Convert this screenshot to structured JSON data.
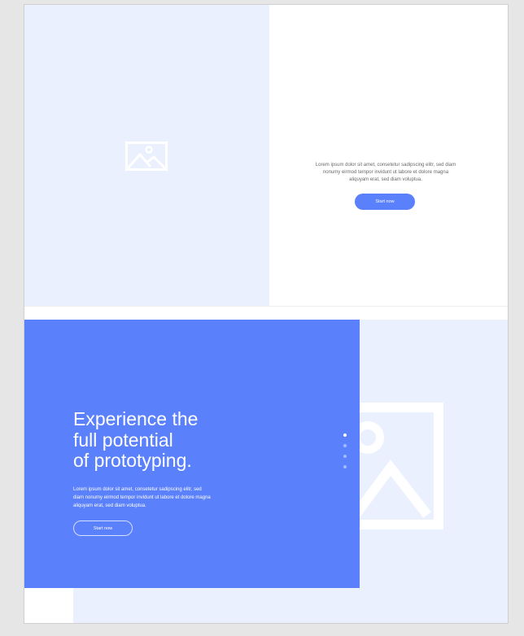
{
  "section1": {
    "image_icon": "image-placeholder-icon",
    "description": "Lorem ipsum dolor sit amet, consetetur sadipscing elitr, sed diam nonumy eirmod tempor invidunt ut labore et dolore magna aliquyam erat, sed diam voluptua.",
    "button_label": "Start now"
  },
  "section2": {
    "title_line1": "Experience the",
    "title_line2": "full potential",
    "title_line3": "of prototyping.",
    "description": "Lorem ipsum dolor sit amet, consetetur sadipscing elitr, sed diam nonumy eirmod tempor invidunt ut labore et dolore magna aliquyam erat, sed diam voluptua.",
    "button_label": "Start now",
    "image_icon": "image-placeholder-icon",
    "slider_dot_count": 4,
    "active_slide": 1
  },
  "colors": {
    "accent_blue": "#5a80fb",
    "light_blue_bg": "#eaf0fe",
    "page_bg": "#e6e6e6",
    "text_gray": "#6a6a6a",
    "white": "#ffffff"
  }
}
